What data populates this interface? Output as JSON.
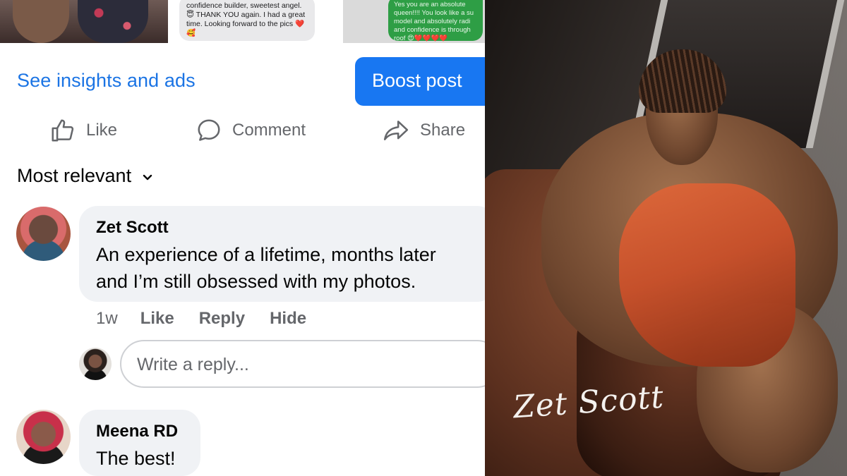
{
  "top_strip": {
    "middle_text": "confidence builder, sweetest angel. 😇 THANK YOU again. I had a great time. Looking forward to the pics ❤️🥰",
    "right_text": "Yes you are an absolute queen!!!! You look like a su model and absolutely radi and confidence is through roof 😍❤️❤️❤️❤️"
  },
  "actions": {
    "insights_label": "See insights and ads",
    "boost_label": "Boost post"
  },
  "reactions": {
    "like": {
      "label": "Like",
      "icon": "thumbs-up-icon"
    },
    "comment": {
      "label": "Comment",
      "icon": "speech-bubble-icon"
    },
    "share": {
      "label": "Share",
      "icon": "share-arrow-icon"
    }
  },
  "sort": {
    "label": "Most relevant",
    "icon": "chevron-down-icon"
  },
  "comments": [
    {
      "author": "Zet Scott",
      "text_line1": "An experience of a lifetime, months later",
      "text_line2": "and I’m still obsessed with my photos.",
      "time": "1w",
      "actions": [
        "Like",
        "Reply",
        "Hide"
      ]
    },
    {
      "author": "Meena RD",
      "text": "The best!"
    }
  ],
  "reply": {
    "placeholder": "Write a reply..."
  },
  "photo": {
    "signature": "Zet Scott"
  },
  "colors": {
    "accent": "#1877f2",
    "link": "#1b74e4",
    "muted": "#65676b",
    "bubble": "#f0f2f5"
  }
}
